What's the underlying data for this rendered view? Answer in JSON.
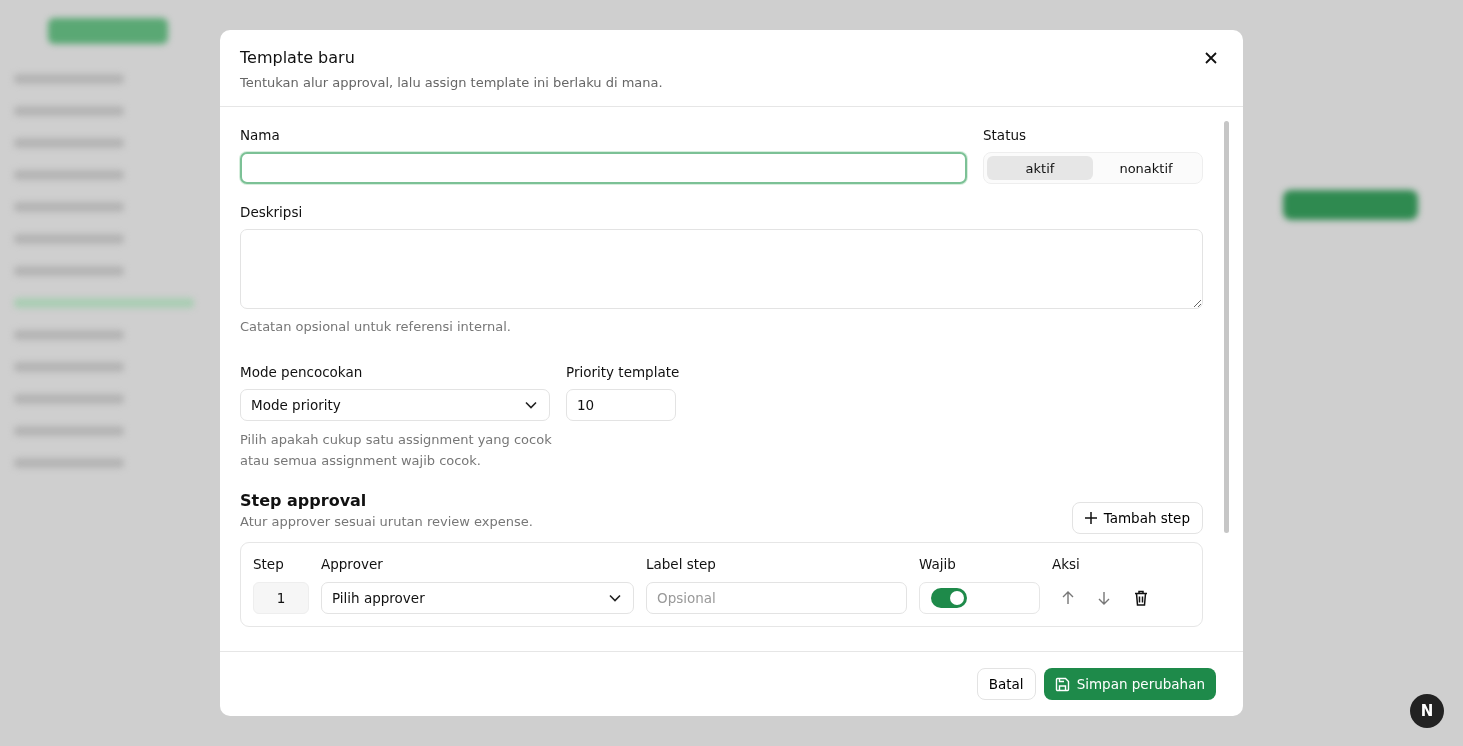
{
  "dialog": {
    "title": "Template baru",
    "subtitle": "Tentukan alur approval, lalu assign template ini berlaku di mana."
  },
  "name_field": {
    "label": "Nama",
    "focused": true
  },
  "status": {
    "label": "Status",
    "options": [
      {
        "label": "aktif",
        "selected": true
      },
      {
        "label": "nonaktif",
        "selected": false
      }
    ]
  },
  "description": {
    "label": "Deskripsi",
    "hint": "Catatan opsional untuk referensi internal."
  },
  "match_mode": {
    "label": "Mode pencocokan",
    "value": "Mode priority",
    "hint": "Pilih apakah cukup satu assignment yang cocok atau semua assignment wajib cocok."
  },
  "priority": {
    "label": "Priority template",
    "value": "10"
  },
  "steps_section": {
    "title": "Step approval",
    "subtitle": "Atur approver sesuai urutan review expense.",
    "add_button": "Tambah step"
  },
  "steps_table": {
    "columns": [
      "Step",
      "Approver",
      "Label step",
      "Wajib",
      "Aksi"
    ],
    "rows": [
      {
        "step": "1",
        "approver": "Pilih approver",
        "label_placeholder": "Opsional",
        "required": true
      }
    ]
  },
  "footer": {
    "cancel": "Batal",
    "save": "Simpan perubahan"
  },
  "dev_badge": "N"
}
